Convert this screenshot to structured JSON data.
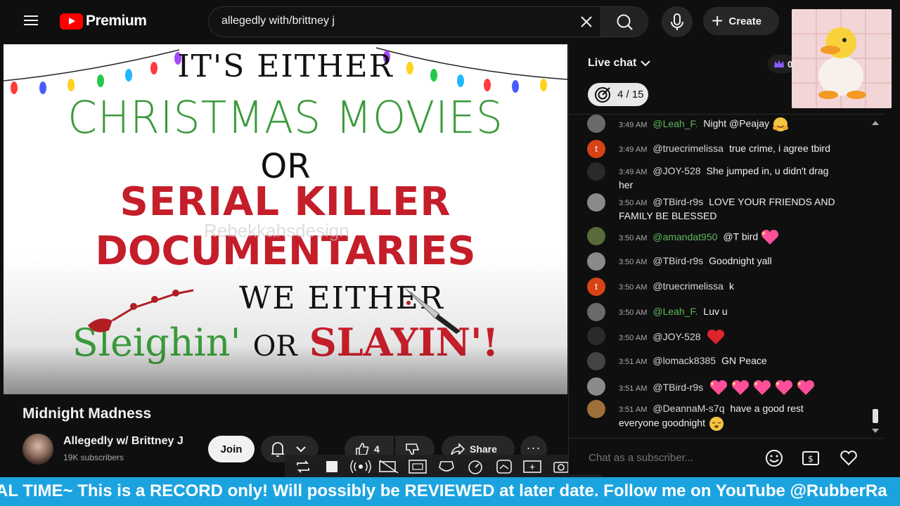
{
  "app": {
    "brand": "Premium"
  },
  "search": {
    "query": "allegedly with/brittney j"
  },
  "header": {
    "create_label": "Create"
  },
  "video": {
    "title": "Midnight Madness",
    "artwork": {
      "line1": "IT'S EITHER",
      "line2": "CHRISTMAS MOVIES",
      "line3": "OR",
      "line4": "SERIAL KILLER",
      "line5": "DOCUMENTARIES",
      "line6": "WE EITHER",
      "line7a": "Sleighin'",
      "line7b": "OR",
      "line7c": "SLAYIN'!",
      "watermark": "Rebekkahsdesign"
    }
  },
  "channel": {
    "name": "Allegedly w/ Brittney J",
    "subscribers": "19K subscribers",
    "join_label": "Join"
  },
  "actions": {
    "like_count": "4",
    "share_label": "Share"
  },
  "chat": {
    "title": "Live chat",
    "crown_count": "0",
    "goal_progress": "4 / 15",
    "input_placeholder": "Chat as a subscriber...",
    "messages": [
      {
        "time": "3:49 AM",
        "author": "@Leah_F.",
        "member": true,
        "text": "Night @Peajay",
        "emoji": "hug",
        "avatar_color": "#6a6a6a"
      },
      {
        "time": "3:49 AM",
        "author": "@truecrimelissa",
        "member": false,
        "text": "true crime, i agree tbird",
        "emoji": "",
        "avatar_color": "#d84315",
        "avatar_letter": "t"
      },
      {
        "time": "3:49 AM",
        "author": "@JOY-528",
        "member": false,
        "text": "She jumped in, u didn't drag her",
        "emoji": "",
        "avatar_color": "#2a2a2a"
      },
      {
        "time": "3:50 AM",
        "author": "@TBird-r9s",
        "member": false,
        "text": "LOVE YOUR FRIENDS AND FAMILY BE BLESSED",
        "emoji": "",
        "avatar_color": "#8a8a8a"
      },
      {
        "time": "3:50 AM",
        "author": "@amandat950",
        "member": true,
        "text": "@T bird",
        "emoji": "heart-sparkle",
        "avatar_color": "#5a6a3a"
      },
      {
        "time": "3:50 AM",
        "author": "@TBird-r9s",
        "member": false,
        "text": "Goodnight yall",
        "emoji": "",
        "avatar_color": "#8a8a8a"
      },
      {
        "time": "3:50 AM",
        "author": "@truecrimelissa",
        "member": false,
        "text": "k",
        "emoji": "",
        "avatar_color": "#d84315",
        "avatar_letter": "t"
      },
      {
        "time": "3:50 AM",
        "author": "@Leah_F.",
        "member": true,
        "text": "Luv u",
        "emoji": "",
        "avatar_color": "#6a6a6a"
      },
      {
        "time": "3:50 AM",
        "author": "@JOY-528",
        "member": false,
        "text": "",
        "emoji": "red-heart",
        "avatar_color": "#2a2a2a"
      },
      {
        "time": "3:51 AM",
        "author": "@lomack8385",
        "member": false,
        "text": "GN Peace",
        "emoji": "",
        "avatar_color": "#444"
      },
      {
        "time": "3:51 AM",
        "author": "@TBird-r9s",
        "member": false,
        "text": "",
        "emoji": "hearts-5",
        "avatar_color": "#8a8a8a"
      },
      {
        "time": "3:51 AM",
        "author": "@DeannaM-s7q",
        "member": false,
        "text": "have a good rest everyone goodnight",
        "emoji": "sleepy",
        "avatar_color": "#a0703a"
      }
    ]
  },
  "ticker": {
    "text": "AL TIME~ This is a RECORD only! Will possibly be REVIEWED at later date. Follow me on YouTube @RubberRa"
  },
  "colors": {
    "background": "#0f0f0f",
    "brand_red": "#ff0000",
    "member_green": "#5cb85c",
    "ticker_blue": "#1ba3df"
  },
  "icons": {
    "menu": "hamburger-icon",
    "search": "search-icon",
    "clear": "close-icon",
    "mic": "mic-icon",
    "bell": "bell-icon",
    "like": "thumbs-up-icon",
    "share": "share-icon"
  }
}
